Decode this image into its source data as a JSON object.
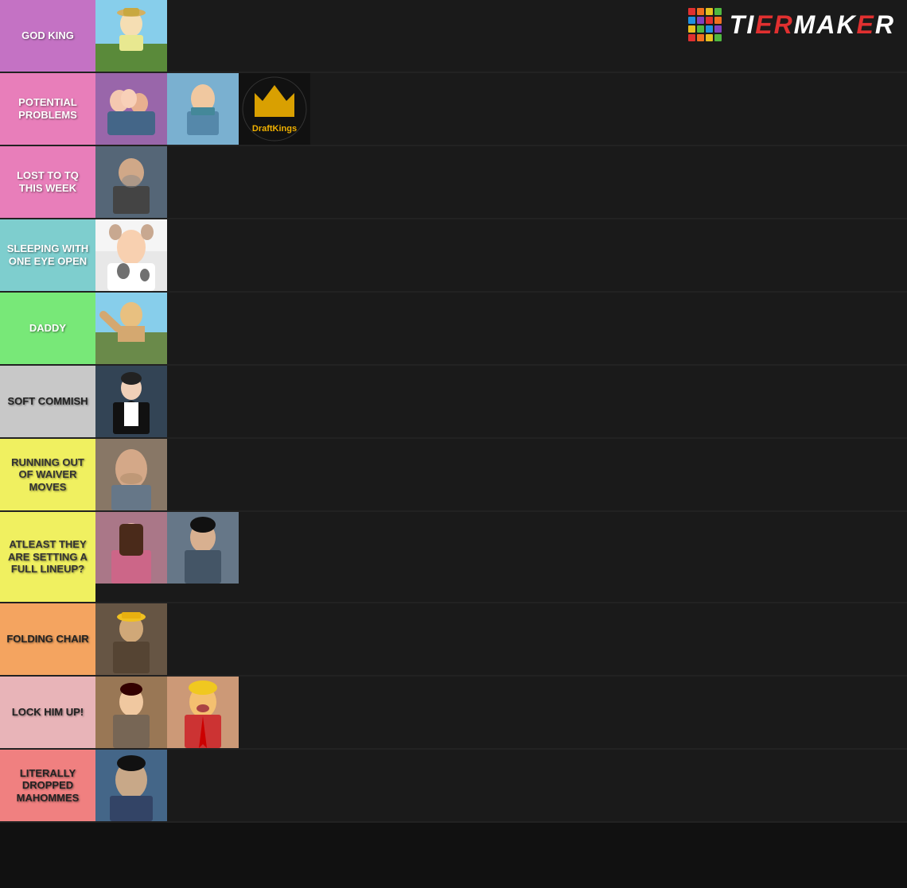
{
  "logo": {
    "brand_ti": "Ti",
    "brand_er": "er",
    "brand_maker": "Maker",
    "full_text": "TiERMAKER"
  },
  "tiers": [
    {
      "id": "god-king",
      "label": "GOD KING",
      "color": "#c472c4",
      "items_count": 1,
      "items": [
        {
          "id": "gk1",
          "bg": "#c8a87a",
          "description": "man in hat outdoor photo"
        }
      ]
    },
    {
      "id": "potential-problems",
      "label": "POTENTIAL PROBLEMS",
      "color": "#e87eba",
      "items_count": 3,
      "items": [
        {
          "id": "pp1",
          "bg": "#9966aa",
          "description": "group of men selfie"
        },
        {
          "id": "pp2",
          "bg": "#4488bb",
          "description": "man in blue outdoors"
        },
        {
          "id": "pp3",
          "bg": "#000000",
          "description": "DraftKings logo"
        }
      ]
    },
    {
      "id": "lost-to-tq",
      "label": "LOST TO TQ THIS WEEK",
      "color": "#e87eba",
      "items_count": 1,
      "items": [
        {
          "id": "lt1",
          "bg": "#556677",
          "description": "man face photo"
        }
      ]
    },
    {
      "id": "sleeping",
      "label": "SLEEPING WITH ONE EYE OPEN",
      "color": "#7ecece",
      "items_count": 1,
      "items": [
        {
          "id": "sl1",
          "bg": "#c8a060",
          "description": "person in animal costume"
        }
      ]
    },
    {
      "id": "daddy",
      "label": "DADDY",
      "color": "#78e878",
      "items_count": 1,
      "items": [
        {
          "id": "d1",
          "bg": "#80a060",
          "description": "shirtless man photo"
        }
      ]
    },
    {
      "id": "soft-commish",
      "label": "SOFT COMMISH",
      "color": "#c8c8c8",
      "items_count": 1,
      "items": [
        {
          "id": "sc1",
          "bg": "#334455",
          "description": "man in tuxedo"
        }
      ]
    },
    {
      "id": "running-out",
      "label": "RUNNING OUT OF WAIVER MOVES",
      "color": "#f0f060",
      "items_count": 1,
      "items": [
        {
          "id": "ro1",
          "bg": "#887766",
          "description": "man face close up"
        }
      ]
    },
    {
      "id": "atleast",
      "label": "ATLEAST THEY ARE SETTING A FULL LINEUP?",
      "color": "#f0f060",
      "items_count": 2,
      "items": [
        {
          "id": "al1",
          "bg": "#aa7788",
          "description": "person photo"
        },
        {
          "id": "al2",
          "bg": "#667788",
          "description": "man face photo"
        }
      ]
    },
    {
      "id": "folding-chair",
      "label": "FOLDING CHAIR",
      "color": "#f4a460",
      "items_count": 1,
      "items": [
        {
          "id": "fc1",
          "bg": "#665544",
          "description": "man with yellow hat"
        }
      ]
    },
    {
      "id": "lock-him-up",
      "label": "LOCK HIM UP!",
      "color": "#e8b4b8",
      "items_count": 2,
      "items": [
        {
          "id": "lhu1",
          "bg": "#997755",
          "description": "young man photo"
        },
        {
          "id": "lhu2",
          "bg": "#cc9977",
          "description": "Trump photo"
        }
      ]
    },
    {
      "id": "literally-dropped",
      "label": "LITERALLY DROPPED MAHOMMES",
      "color": "#f08080",
      "items_count": 1,
      "items": [
        {
          "id": "ldm1",
          "bg": "#446688",
          "description": "man face selfie"
        }
      ]
    }
  ],
  "logo_colors": [
    "#e03030",
    "#f07020",
    "#e8c020",
    "#50b840",
    "#2090e0",
    "#8040c0",
    "#e03030",
    "#f07020",
    "#e8c020",
    "#50b840",
    "#2090e0",
    "#8040c0",
    "#e03030",
    "#f07020",
    "#e8c020",
    "#50b840"
  ]
}
